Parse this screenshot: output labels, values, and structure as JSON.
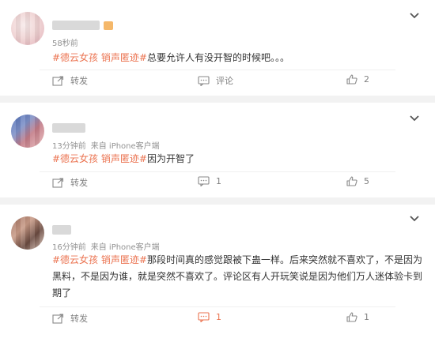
{
  "comments": [
    {
      "time": "58秒前",
      "source": "",
      "tags": [
        "#德云女孩 销声匿迹#"
      ],
      "body": "总要允许人有没开智的时候吧。。。",
      "forward_label": "转发",
      "comment_label": "评论",
      "like_count": "2"
    },
    {
      "time": "13分钟前",
      "source": "来自 iPhone客户端",
      "tags": [
        "#德云女孩 销声匿迹#"
      ],
      "body": "因为开智了",
      "forward_label": "转发",
      "comment_label": "1",
      "like_count": "5"
    },
    {
      "time": "16分钟前",
      "source": "来自 iPhone客户端",
      "tags": [
        "#德云女孩 销声匿迹#"
      ],
      "body": "那段时间真的感觉跟被下蛊一样。后来突然就不喜欢了，不是因为黑料，不是因为谁，就是突然不喜欢了。评论区有人开玩笑说是因为他们万人迷体验卡到期了",
      "forward_label": "转发",
      "comment_label": "1",
      "like_count": "1"
    }
  ],
  "colors": {
    "accent": "#eb7350",
    "meta": "#939393",
    "action": "#808080",
    "background": "#f2f2f2"
  },
  "icons": [
    "chevron-down-icon",
    "forward-icon",
    "comment-icon",
    "like-icon"
  ]
}
